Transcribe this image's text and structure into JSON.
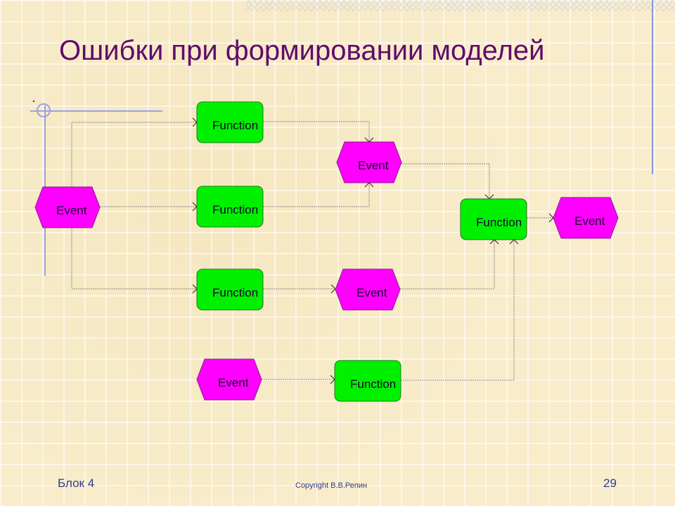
{
  "slide": {
    "title": "Ошибки при формировании моделей",
    "footer": {
      "block": "Блок 4",
      "copyright": "Copyright В.В.Репин",
      "page_number": "29"
    }
  },
  "colors": {
    "title": "#5f0b6b",
    "footer_text": "#2e3b8c",
    "function_fill": "#00f000",
    "event_fill": "#ff00ff",
    "connector": "#8a8a8a",
    "guide_lines": "#9aa3e0"
  },
  "diagram": {
    "nodes": [
      {
        "id": "event-start",
        "type": "event",
        "label": "Event"
      },
      {
        "id": "function-1",
        "type": "function",
        "label": "Function"
      },
      {
        "id": "function-2",
        "type": "function",
        "label": "Function"
      },
      {
        "id": "function-3",
        "type": "function",
        "label": "Function"
      },
      {
        "id": "event-middle",
        "type": "event",
        "label": "Event"
      },
      {
        "id": "event-lower",
        "type": "event",
        "label": "Event"
      },
      {
        "id": "function-final",
        "type": "function",
        "label": "Function"
      },
      {
        "id": "event-end",
        "type": "event",
        "label": "Event"
      },
      {
        "id": "event-orphan",
        "type": "event",
        "label": "Event"
      },
      {
        "id": "function-orphan",
        "type": "function",
        "label": "Function"
      }
    ],
    "edges": [
      {
        "from": "event-start",
        "to": "function-1"
      },
      {
        "from": "event-start",
        "to": "function-2"
      },
      {
        "from": "event-start",
        "to": "function-3"
      },
      {
        "from": "function-1",
        "to": "event-middle"
      },
      {
        "from": "function-2",
        "to": "event-middle"
      },
      {
        "from": "function-3",
        "to": "event-lower"
      },
      {
        "from": "event-middle",
        "to": "function-final"
      },
      {
        "from": "event-lower",
        "to": "function-final"
      },
      {
        "from": "function-orphan",
        "to": "function-final"
      },
      {
        "from": "event-orphan",
        "to": "function-orphan"
      },
      {
        "from": "function-final",
        "to": "event-end"
      }
    ]
  }
}
